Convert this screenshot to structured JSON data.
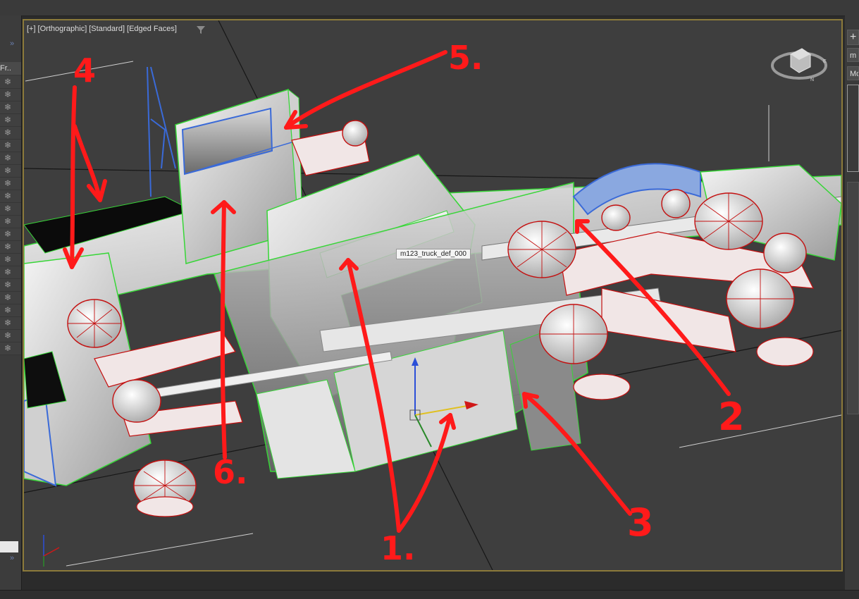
{
  "viewport": {
    "labels": [
      "[+]",
      "[Orthographic]",
      "[Standard]",
      "[Edged Faces]"
    ],
    "object_tooltip": "m123_truck_def_000"
  },
  "annotations": [
    "1.",
    "2",
    "3",
    "4",
    "5.",
    "6."
  ],
  "left_panel": {
    "header": "Fr.."
  },
  "right_panel": {
    "button_1": "m",
    "button_2": "Mo"
  },
  "colors": {
    "annotation": "#ff1a1a",
    "wire_green": "#37d637",
    "wire_red": "#c41010",
    "wire_blue": "#3a6ad8",
    "viewport_border": "#8c7a3a"
  }
}
